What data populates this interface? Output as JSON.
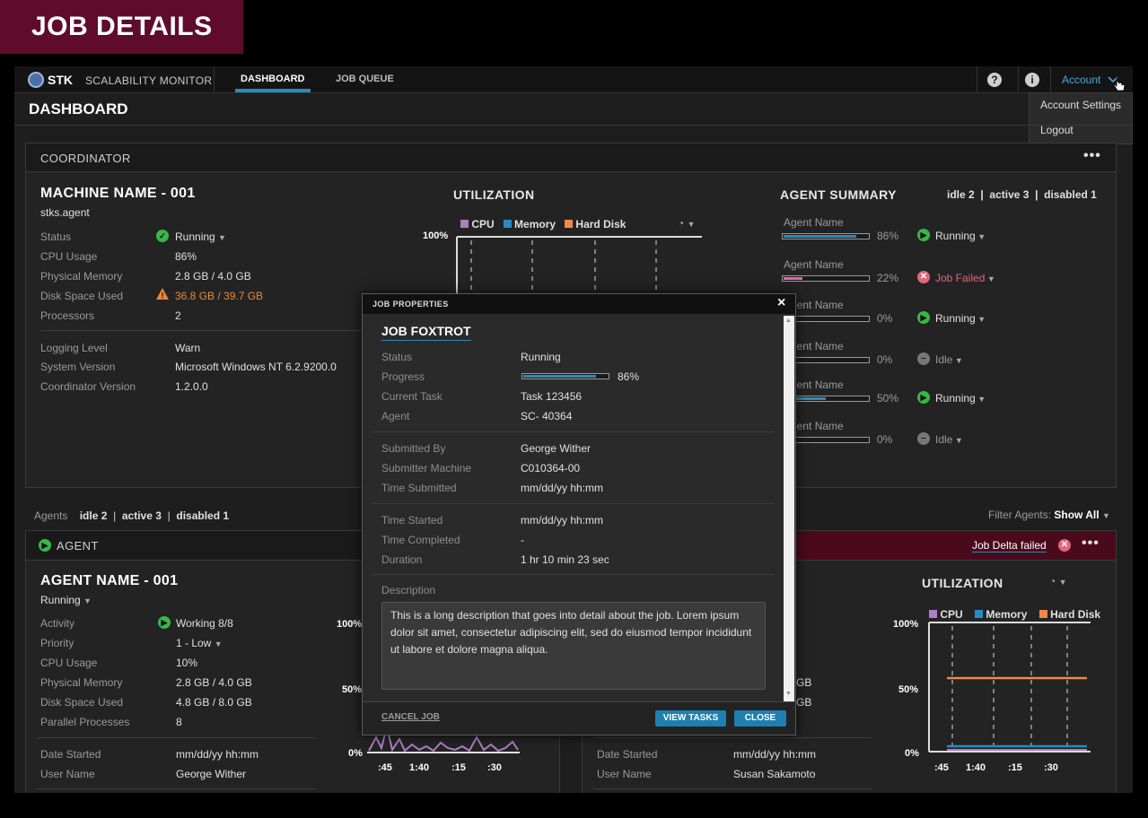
{
  "banner": {
    "title": "JOB DETAILS"
  },
  "nav": {
    "logo": "STK",
    "brand": "SCALABILITY MONITOR",
    "tabs": [
      "DASHBOARD",
      "JOB QUEUE"
    ],
    "help": "?",
    "info": "i",
    "account": "Account",
    "account_menu": [
      "Account Settings",
      "Logout"
    ]
  },
  "page": {
    "title": "DASHBOARD"
  },
  "coordinator": {
    "header": "COORDINATOR",
    "machine_name": "MACHINE NAME -  001",
    "machine_sub": "stks.agent",
    "rows": [
      {
        "label": "Status",
        "value": "Running"
      },
      {
        "label": "CPU Usage",
        "value": "86%"
      },
      {
        "label": "Physical Memory",
        "value": "2.8 GB  /  4.0 GB"
      },
      {
        "label": "Disk Space Used",
        "value": "36.8 GB  /  39.7 GB"
      },
      {
        "label": "Processors",
        "value": "2"
      }
    ],
    "rows2": [
      {
        "label": "Logging Level",
        "value": "Warn"
      },
      {
        "label": "System Version",
        "value": "Microsoft Windows NT 6.2.9200.0"
      },
      {
        "label": "Coordinator Version",
        "value": "1.2.0.0"
      }
    ],
    "utilization": {
      "title": "UTILIZATION",
      "legend": [
        "CPU",
        "Memory",
        "Hard Disk"
      ],
      "colors": {
        "cpu": "#b07cc6",
        "memory": "#2a8bbf",
        "disk": "#f0884a"
      },
      "y_top": "100%"
    },
    "agent_summary": {
      "title": "AGENT SUMMARY",
      "counts": {
        "idle": "idle 2",
        "active": "active 3",
        "disabled": "disabled 1"
      },
      "sep": "|",
      "agents": [
        {
          "name": "Agent Name",
          "pct": "86%",
          "fill": 0.86,
          "status": "Running",
          "kind": "ok"
        },
        {
          "name": "Agent Name",
          "pct": "22%",
          "fill": 0.22,
          "status": "Job Failed",
          "kind": "fail"
        },
        {
          "name": "Agent Name",
          "pct": "0%",
          "fill": 0,
          "status": "Running",
          "kind": "ok"
        },
        {
          "name": "Agent Name",
          "pct": "0%",
          "fill": 0,
          "status": "Idle",
          "kind": "idle"
        },
        {
          "name": "Agent Name",
          "pct": "50%",
          "fill": 0.5,
          "status": "Running",
          "kind": "ok"
        },
        {
          "name": "Agent Name",
          "pct": "0%",
          "fill": 0,
          "status": "Idle",
          "kind": "idle"
        }
      ]
    }
  },
  "agents_bar": {
    "label": "Agents",
    "idle": "idle 2",
    "active": "active 3",
    "disabled": "disabled 1",
    "sep": "|",
    "filter_label": "Filter Agents:",
    "filter_value": "Show All"
  },
  "agent_panel": {
    "header": "AGENT",
    "name": "AGENT NAME -  001",
    "status": "Running",
    "rows": [
      {
        "label": "Activity",
        "value": "Working 8/8"
      },
      {
        "label": "Priority",
        "value": "1 - Low"
      },
      {
        "label": "CPU Usage",
        "value": "10%"
      },
      {
        "label": "Physical Memory",
        "value": "2.8 GB  /  4.0 GB"
      },
      {
        "label": "Disk Space Used",
        "value": "4.8 GB  /  8.0 GB"
      },
      {
        "label": "Parallel Processes",
        "value": "8"
      }
    ],
    "rows2": [
      {
        "label": "Date Started",
        "value": "mm/dd/yy hh:mm"
      },
      {
        "label": "User Name",
        "value": "George Wither"
      }
    ],
    "chart": {
      "y100": "100%",
      "y50": "50%",
      "y0": "0%",
      "x": [
        ":45",
        "1:40",
        ":15",
        ":30"
      ]
    }
  },
  "agent_panel2": {
    "failed_text": "Job Delta failed",
    "val_gb1": "GB",
    "val_gb2": "GB",
    "rows2": [
      {
        "label": "Date Started",
        "value": "mm/dd/yy hh:mm"
      },
      {
        "label": "User Name",
        "value": "Susan Sakamoto"
      }
    ],
    "utilization": {
      "title": "UTILIZATION",
      "legend": [
        "CPU",
        "Memory",
        "Hard Disk"
      ],
      "y100": "100%",
      "y50": "50%",
      "y0": "0%",
      "x": [
        ":45",
        "1:40",
        ":15",
        ":30"
      ]
    }
  },
  "modal": {
    "header": "JOB PROPERTIES",
    "close": "×",
    "job_name": "JOB FOXTROT",
    "group1": [
      {
        "label": "Status",
        "value": "Running"
      },
      {
        "label": "Progress",
        "value": "86%"
      },
      {
        "label": "Current Task",
        "value": "Task 123456"
      },
      {
        "label": "Agent",
        "value": "SC- 40364"
      }
    ],
    "progress": 0.86,
    "group2": [
      {
        "label": "Submitted By",
        "value": "George Wither"
      },
      {
        "label": "Submitter Machine",
        "value": "C010364-00"
      },
      {
        "label": "Time Submitted",
        "value": "mm/dd/yy hh:mm"
      }
    ],
    "group3": [
      {
        "label": "Time Started",
        "value": "mm/dd/yy hh:mm"
      },
      {
        "label": "Time Completed",
        "value": "-"
      },
      {
        "label": "Duration",
        "value": "1 hr  10 min  23 sec"
      }
    ],
    "description_label": "Description",
    "description": "This is a long description that goes into detail about the job. Lorem ipsum dolor sit amet, consectetur adipiscing elit, sed do eiusmod tempor incididunt ut labore et dolore magna aliqua.",
    "cancel": "CANCEL JOB",
    "view_tasks": "VIEW TASKS",
    "close_btn": "CLOSE"
  }
}
